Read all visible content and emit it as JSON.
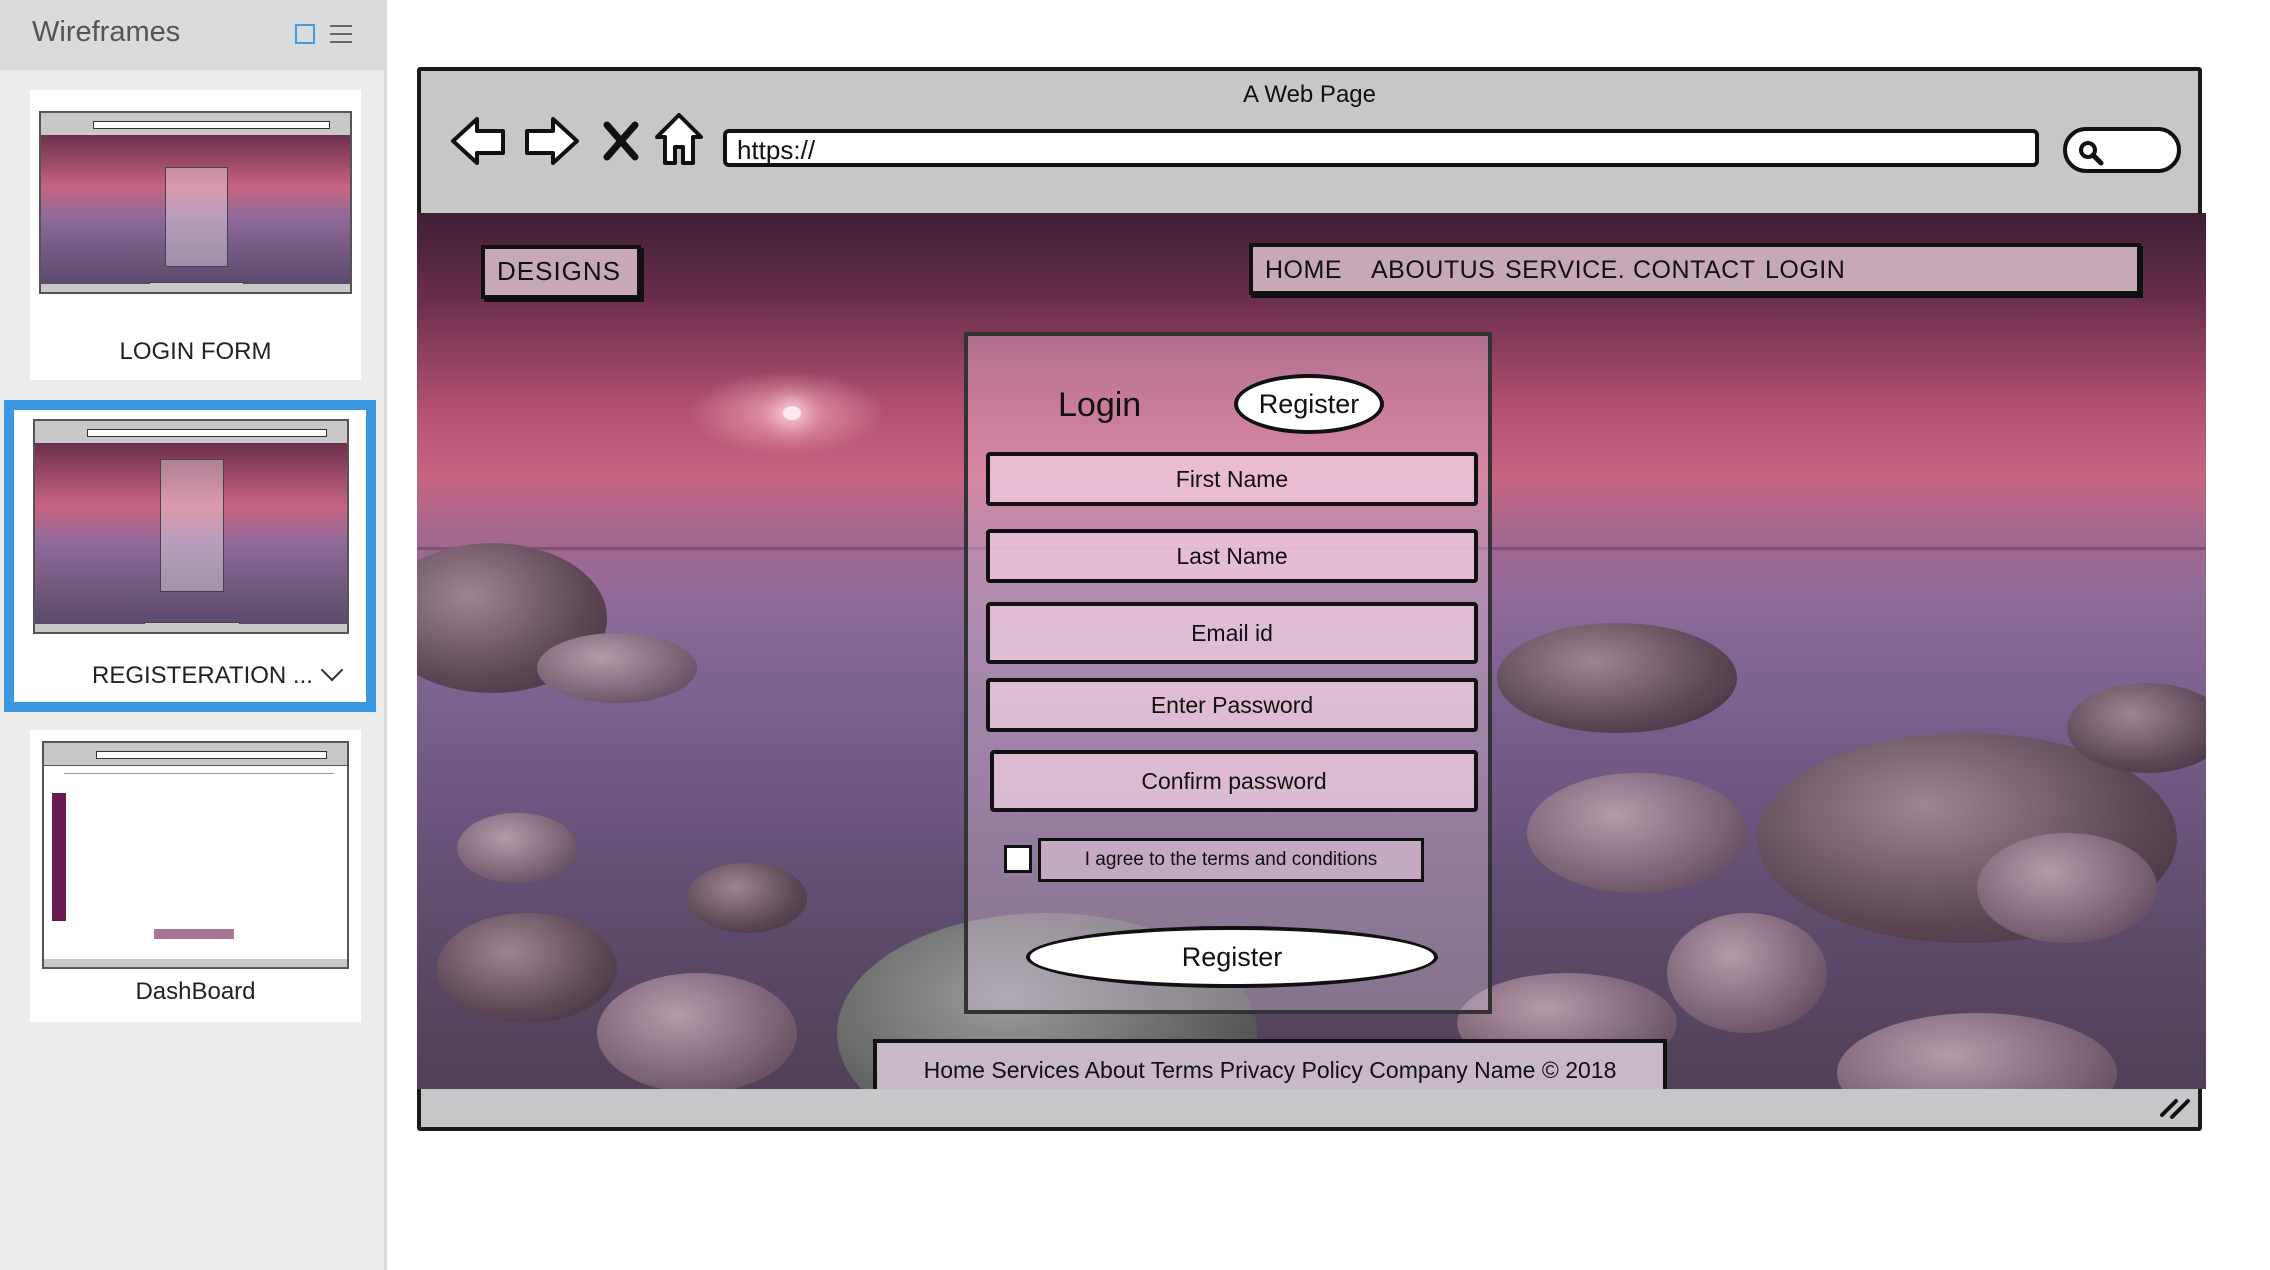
{
  "sidebar": {
    "title": "Wireframes",
    "pages": [
      {
        "label": "LOGIN FORM"
      },
      {
        "label": "REGISTERATION ..."
      },
      {
        "label": "DashBoard"
      }
    ]
  },
  "browser": {
    "page_title": "A Web Page",
    "url": "https://"
  },
  "site": {
    "brand": "DESIGNS",
    "nav": [
      "HOME",
      "ABOUTUS",
      "SERVICE.",
      "CONTACT",
      "LOGIN"
    ]
  },
  "form": {
    "tab_login": "Login",
    "tab_register": "Register",
    "fields": [
      "First Name",
      "Last Name",
      "Email id",
      "Enter Password",
      "Confirm password"
    ],
    "agree_label": "I agree to the terms and conditions",
    "submit_label": "Register"
  },
  "footer": {
    "text": "Home Services About Terms Privacy Policy Company Name © 2018"
  },
  "colors": {
    "selected_accent": "#3a97e2",
    "chrome_grey": "#c7c7c9"
  }
}
